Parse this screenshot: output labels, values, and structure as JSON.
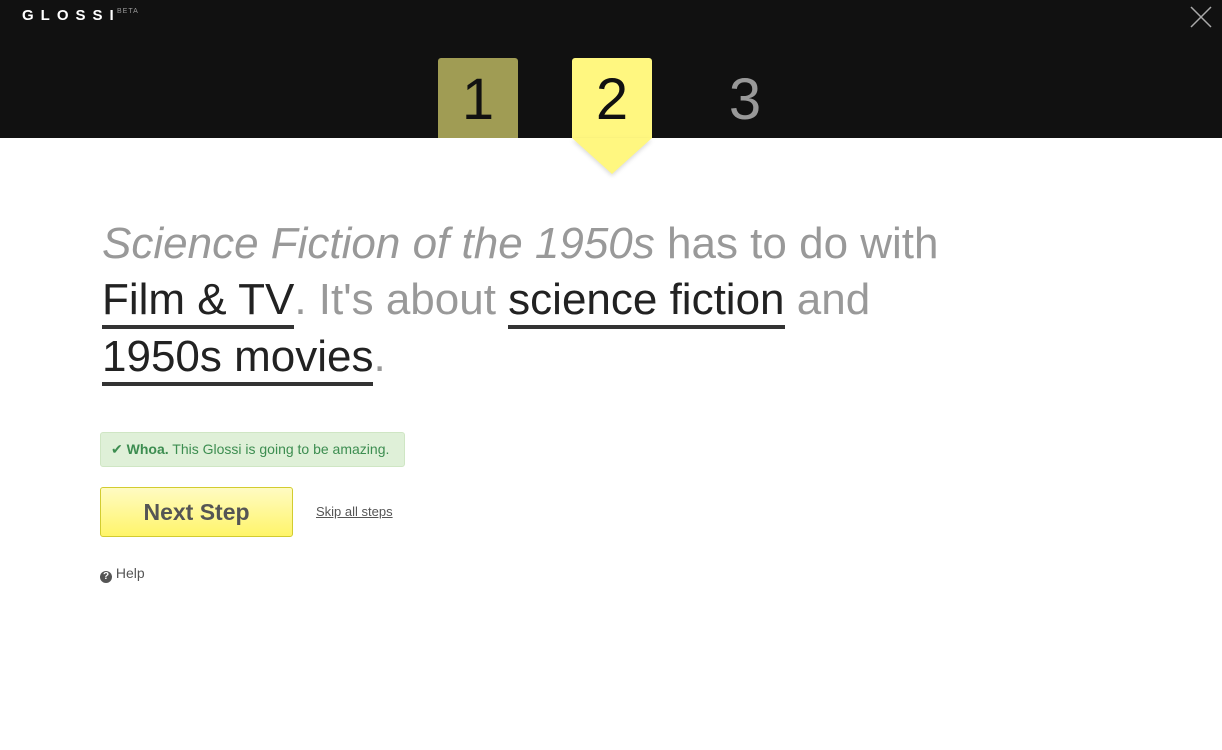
{
  "header": {
    "logo": "GLOSSI",
    "beta": "BETA",
    "close_icon": "close-icon"
  },
  "steps": [
    {
      "label": "1",
      "state": "completed"
    },
    {
      "label": "2",
      "state": "active"
    },
    {
      "label": "3",
      "state": "upcoming"
    }
  ],
  "headline": {
    "title": "Science Fiction of the 1950s",
    "t1": " has to do with ",
    "category": "Film & TV",
    "t2": ". It's about ",
    "tag1": "science fiction",
    "t3": " and ",
    "tag2": "1950s movies",
    "t4": "."
  },
  "alert": {
    "icon": "check-icon",
    "bold": "Whoa.",
    "text": " This Glossi is going to be amazing."
  },
  "actions": {
    "next": "Next Step",
    "skip": "Skip all steps",
    "help": "Help"
  },
  "colors": {
    "step_active": "#fff780",
    "step_done": "#a09c54",
    "alert_bg": "#dff0d8",
    "alert_text": "#3c8d50"
  }
}
